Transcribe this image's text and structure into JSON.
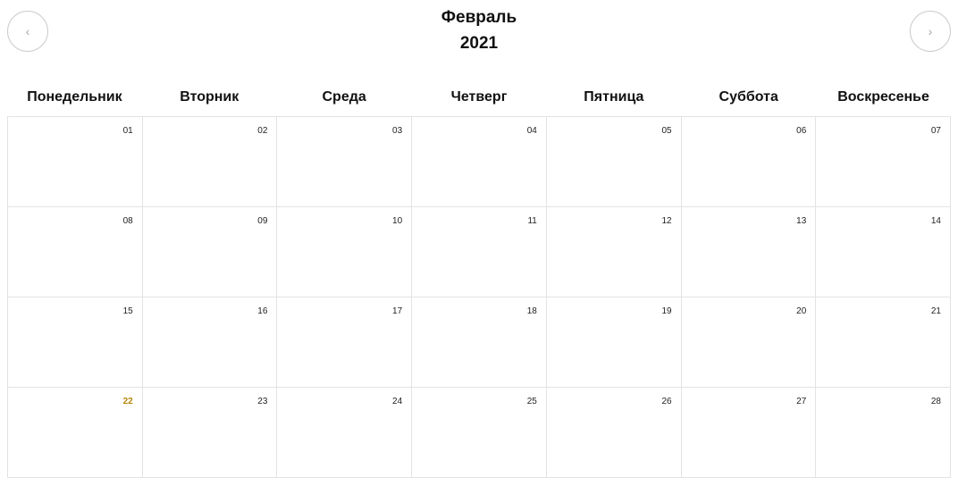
{
  "header": {
    "month": "Февраль",
    "year": "2021",
    "prev_icon": "chevron-left-icon",
    "next_icon": "chevron-right-icon"
  },
  "weekdays": [
    "Понедельник",
    "Вторник",
    "Среда",
    "Четверг",
    "Пятница",
    "Суббота",
    "Воскресенье"
  ],
  "days": [
    "01",
    "02",
    "03",
    "04",
    "05",
    "06",
    "07",
    "08",
    "09",
    "10",
    "11",
    "12",
    "13",
    "14",
    "15",
    "16",
    "17",
    "18",
    "19",
    "20",
    "21",
    "22",
    "23",
    "24",
    "25",
    "26",
    "27",
    "28"
  ],
  "today": "22",
  "colors": {
    "today": "#b8860b",
    "border": "#e3e3e3"
  }
}
